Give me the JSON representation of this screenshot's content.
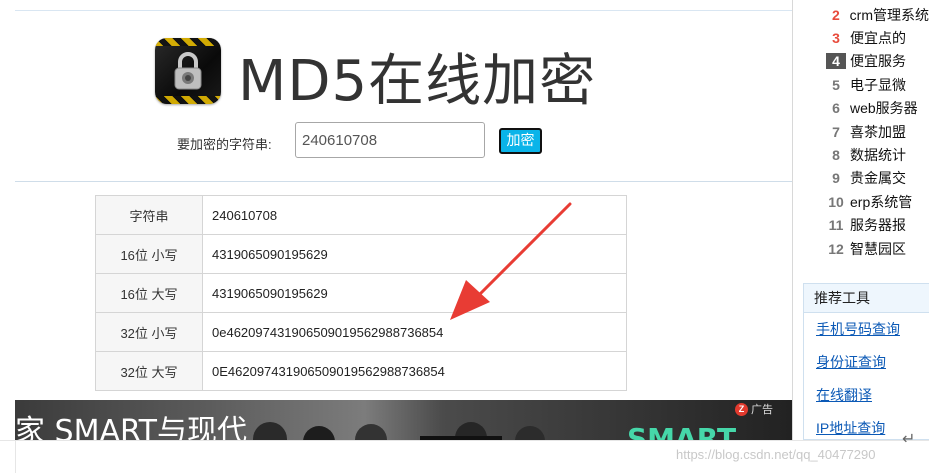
{
  "header": {
    "title": "MD5在线加密"
  },
  "form": {
    "label": "要加密的字符串:",
    "input_value": "240610708",
    "button_label": "加密"
  },
  "results": [
    {
      "label": "字符串",
      "value": "240610708"
    },
    {
      "label": "16位 小写",
      "value": "4319065090195629"
    },
    {
      "label": "16位 大写",
      "value": "4319065090195629"
    },
    {
      "label": "32位 小写",
      "value": "0e462097431906509019562988736854"
    },
    {
      "label": "32位 大写",
      "value": "0E462097431906509019562988736854"
    }
  ],
  "ad": {
    "text_left": "家 SMART与现代",
    "text_right": "SMART",
    "mark_label": "广告"
  },
  "ranking": [
    {
      "num": "2",
      "text": "crm管理系统"
    },
    {
      "num": "3",
      "text": "便宜点的"
    },
    {
      "num": "4",
      "text": "便宜服务"
    },
    {
      "num": "5",
      "text": "电子显微"
    },
    {
      "num": "6",
      "text": "web服务器"
    },
    {
      "num": "7",
      "text": "喜茶加盟"
    },
    {
      "num": "8",
      "text": "数据统计"
    },
    {
      "num": "9",
      "text": "贵金属交"
    },
    {
      "num": "10",
      "text": "erp系统管"
    },
    {
      "num": "11",
      "text": "服务器报"
    },
    {
      "num": "12",
      "text": "智慧园区"
    }
  ],
  "tools": {
    "header": "推荐工具",
    "links": [
      "手机号码查询",
      "身份证查询",
      "在线翻译",
      "IP地址查询"
    ]
  },
  "watermark": "https://blog.csdn.net/qq_40477290",
  "colors": {
    "button_bg": "#0ab4e9",
    "arrow": "#e83c34",
    "link": "#0b59b6",
    "rank_top": "#e84b3c"
  }
}
